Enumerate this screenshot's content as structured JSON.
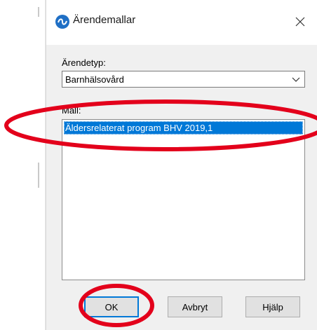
{
  "window": {
    "title": "Ärendemallar",
    "icon": "app-swirl-icon",
    "close_glyph": "✕"
  },
  "form": {
    "case_type_label": "Ärendetyp:",
    "case_type_value": "Barnhälsovård",
    "template_label": "Mall:",
    "templates": [
      {
        "label": "Äldersrelaterat program BHV 2019,1",
        "selected": true
      }
    ]
  },
  "buttons": {
    "ok": "OK",
    "cancel": "Avbryt",
    "help": "Hjälp"
  },
  "colors": {
    "selection": "#0078d7",
    "annotation": "#e3001b",
    "dialog_bg": "#f0f0f0"
  }
}
